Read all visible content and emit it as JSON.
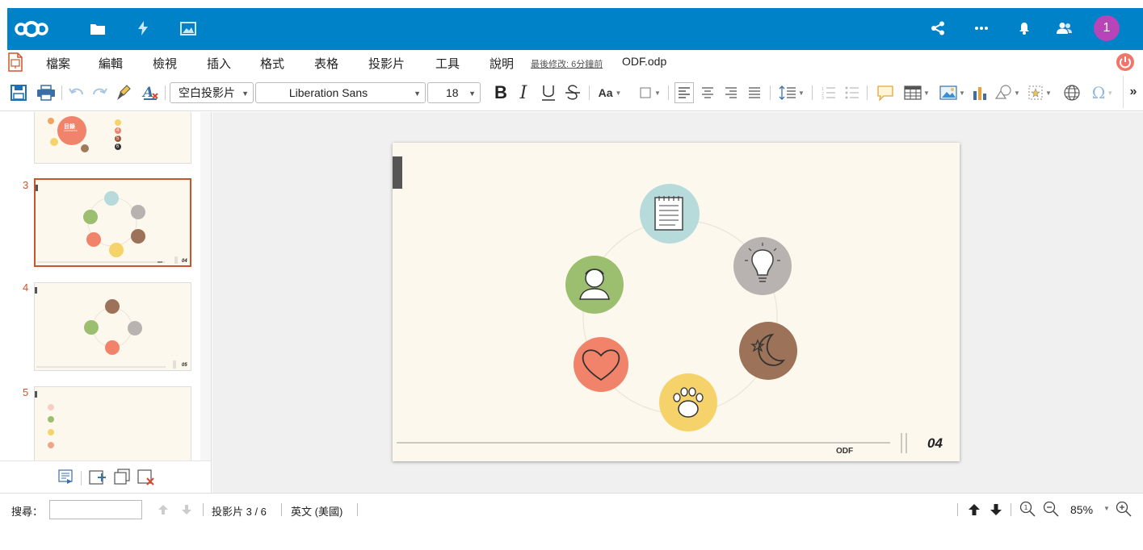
{
  "colors": {
    "brand": "#0082c9",
    "avatar": "#b744b8",
    "accent": "#c8562d",
    "slide_bg": "#fdf8ee"
  },
  "topbar": {
    "apps": [
      "nextcloud-logo",
      "files-icon",
      "activity-icon",
      "gallery-icon"
    ],
    "right_icons": [
      "share-icon",
      "more-icon",
      "notifications-icon",
      "contacts-icon"
    ],
    "avatar_label": "1"
  },
  "menubar": {
    "items": [
      "檔案",
      "編輯",
      "檢視",
      "插入",
      "格式",
      "表格",
      "投影片",
      "工具",
      "說明"
    ],
    "last_modified": "最後修改: 6分鐘前",
    "document_name": "ODF.odp"
  },
  "toolbar": {
    "layout_select": "空白投影片",
    "font_name": "Liberation Sans",
    "font_size": "18",
    "case_label": "Aa",
    "overflow_label": "»"
  },
  "sorter": {
    "slides": [
      {
        "number": "",
        "label": "目錄"
      },
      {
        "number": "3",
        "label": "04"
      },
      {
        "number": "4",
        "label": "05"
      },
      {
        "number": "5",
        "label": ""
      }
    ],
    "thumb1_subtitle": "CONTENTS",
    "thumb1_nums": [
      "4",
      "5",
      "6"
    ],
    "thumb2_footer": "ODF"
  },
  "slide": {
    "footer_text": "ODF",
    "page_number": "04"
  },
  "statusbar": {
    "search_label": "搜尋：",
    "slide_position": "投影片 3 / 6",
    "language": "英文 (美國)",
    "zoom": "85%"
  }
}
